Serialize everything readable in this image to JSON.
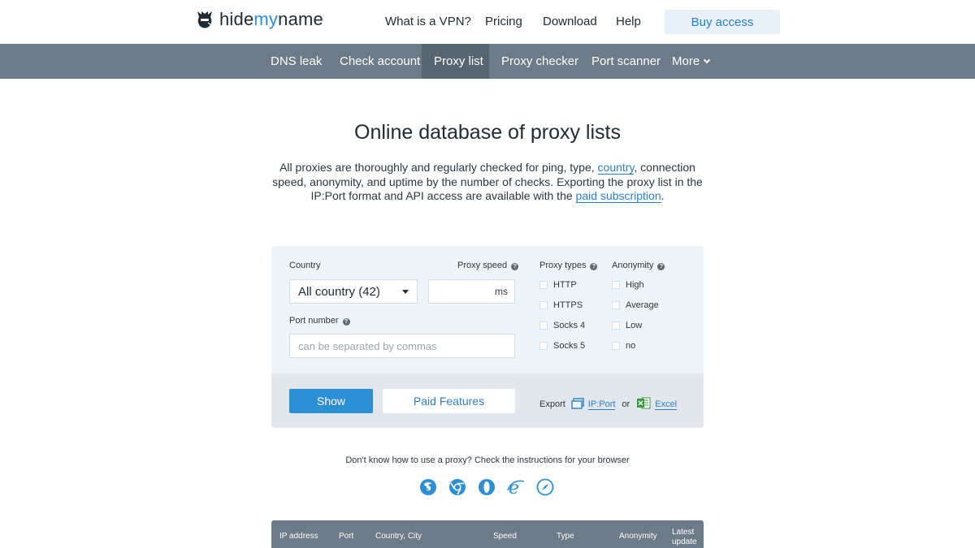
{
  "brand": {
    "name_prefix": "hide",
    "name_accent": "my",
    "name_suffix": "name"
  },
  "topnav": {
    "items": [
      "What is a VPN?",
      "Pricing",
      "Download",
      "Help"
    ],
    "buy_label": "Buy access"
  },
  "subnav": {
    "items": [
      "DNS leak",
      "Check account",
      "Proxy list",
      "Proxy checker",
      "Port scanner",
      "More"
    ],
    "active": "Proxy list"
  },
  "page": {
    "title": "Online database of proxy lists",
    "intro_1": "All proxies are thoroughly and regularly checked for ping, type, ",
    "intro_link_1": "country",
    "intro_2": ", connection speed, anonymity, and uptime by the number of checks. Exporting the proxy list in the IP:Port format and API access are available with the ",
    "intro_link_2": "paid subscription",
    "intro_3": "."
  },
  "filters": {
    "country_label": "Country",
    "country_value": "All country (42)",
    "speed_label": "Proxy speed",
    "speed_unit": "ms",
    "port_label": "Port number",
    "port_placeholder": "can be separated by commas",
    "types_label": "Proxy types",
    "types": [
      "HTTP",
      "HTTPS",
      "Socks 4",
      "Socks 5"
    ],
    "anonymity_label": "Anonymity",
    "anonymity": [
      "High",
      "Average",
      "Low",
      "no"
    ],
    "show_label": "Show",
    "paid_label": "Paid Features",
    "export_label": "Export",
    "export_ipport": "IP:Port",
    "export_or": "or",
    "export_excel": "Excel"
  },
  "browser_help": {
    "text": "Don't know how to use a proxy? Check the instructions for your browser",
    "icons": [
      "firefox-icon",
      "chrome-icon",
      "opera-icon",
      "ie-icon",
      "safari-icon"
    ]
  },
  "table": {
    "headers": [
      "IP address",
      "Port",
      "Country, City",
      "Speed",
      "Type",
      "Anonymity",
      "Latest",
      "update"
    ]
  },
  "colors": {
    "accent": "#2b8fd6",
    "subnav": "#6c7b87",
    "subnav_active": "#56656f",
    "panel": "#eef5fa"
  }
}
